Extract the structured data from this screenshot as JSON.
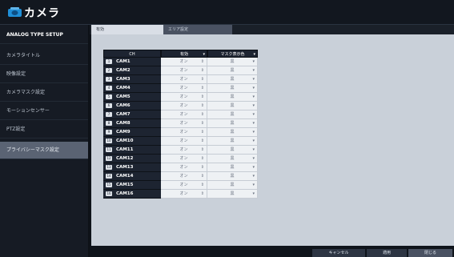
{
  "window": {
    "title": "カメラ",
    "icon": "camera-icon"
  },
  "sidebar": {
    "header": "ANALOG TYPE SETUP",
    "items": [
      {
        "label": "カメラタイトル"
      },
      {
        "label": "映像設定"
      },
      {
        "label": "カメラマスク設定"
      },
      {
        "label": "モーションセンサー"
      },
      {
        "label": "PTZ設定"
      },
      {
        "label": "プライバシーマスク設定",
        "active": true
      }
    ]
  },
  "tabs": [
    {
      "label": "有効",
      "active": true
    },
    {
      "label": "エリア設定",
      "active": false
    }
  ],
  "table": {
    "headers": {
      "ch": "CH",
      "enable": "有効",
      "mask_color": "マスク表示色"
    },
    "rows": [
      {
        "num": "1",
        "cam": "CAM1",
        "enable": "オン",
        "color": "黒"
      },
      {
        "num": "2",
        "cam": "CAM2",
        "enable": "オン",
        "color": "黒"
      },
      {
        "num": "3",
        "cam": "CAM3",
        "enable": "オン",
        "color": "黒"
      },
      {
        "num": "4",
        "cam": "CAM4",
        "enable": "オン",
        "color": "黒"
      },
      {
        "num": "5",
        "cam": "CAM5",
        "enable": "オン",
        "color": "黒"
      },
      {
        "num": "6",
        "cam": "CAM6",
        "enable": "オン",
        "color": "黒"
      },
      {
        "num": "7",
        "cam": "CAM7",
        "enable": "オン",
        "color": "黒"
      },
      {
        "num": "8",
        "cam": "CAM8",
        "enable": "オン",
        "color": "黒"
      },
      {
        "num": "9",
        "cam": "CAM9",
        "enable": "オン",
        "color": "黒"
      },
      {
        "num": "10",
        "cam": "CAM10",
        "enable": "オン",
        "color": "黒"
      },
      {
        "num": "11",
        "cam": "CAM11",
        "enable": "オン",
        "color": "黒"
      },
      {
        "num": "12",
        "cam": "CAM12",
        "enable": "オン",
        "color": "黒"
      },
      {
        "num": "13",
        "cam": "CAM13",
        "enable": "オン",
        "color": "黒"
      },
      {
        "num": "14",
        "cam": "CAM14",
        "enable": "オン",
        "color": "黒"
      },
      {
        "num": "15",
        "cam": "CAM15",
        "enable": "オン",
        "color": "黒"
      },
      {
        "num": "16",
        "cam": "CAM16",
        "enable": "オン",
        "color": "黒"
      }
    ]
  },
  "buttons": {
    "cancel": "キャンセル",
    "save": "適用",
    "close": "閉じる"
  },
  "colors": {
    "accent": "#1f8fd8",
    "header_bg": "#1d2431",
    "panel_bg": "#c9d0d9"
  }
}
